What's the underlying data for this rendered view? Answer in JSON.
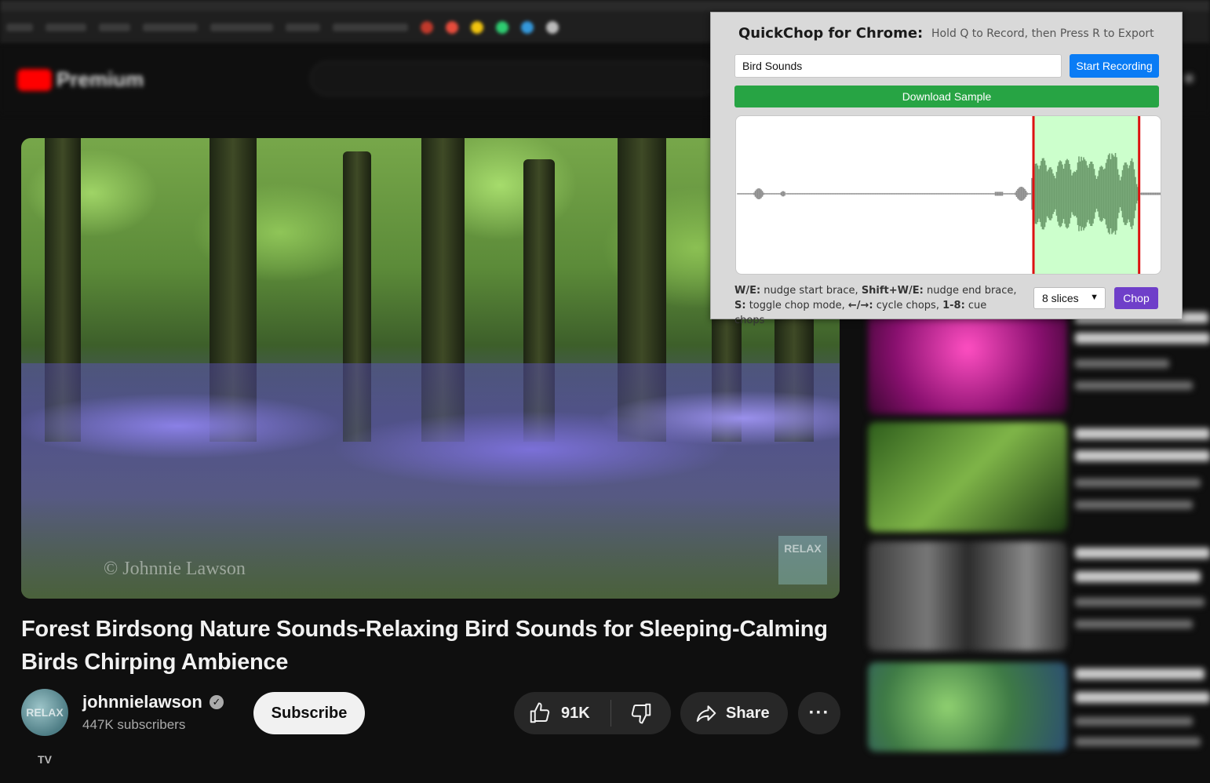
{
  "browser": {
    "bookmark_count": 14
  },
  "youtube": {
    "logo_text": "Premium",
    "video": {
      "watermark": "© Johnnie Lawson",
      "badge": "RELAX",
      "title": "Forest Birdsong Nature Sounds-Relaxing Bird Sounds for Sleeping-Calming Birds Chirping Ambience"
    },
    "channel": {
      "avatar_text": "RELAX TV",
      "name": "johnnielawson",
      "verified_mark": "✓",
      "subscribers": "447K subscribers",
      "subscribe_label": "Subscribe"
    },
    "actions": {
      "like_count": "91K",
      "share_label": "Share",
      "more_label": "···"
    }
  },
  "quickchop": {
    "title": "QuickChop for Chrome:",
    "hint": "Hold Q to Record, then Press R to Export",
    "sample_name_value": "Bird Sounds",
    "start_recording_label": "Start Recording",
    "download_label": "Download Sample",
    "help": {
      "k1": "W/E:",
      "t1": " nudge start brace, ",
      "k2": "Shift+W/E:",
      "t2": " nudge end brace,",
      "k3": "S:",
      "t3": " toggle chop mode, ",
      "k4": "←/→:",
      "t4": " cycle chops, ",
      "k5": "1-8:",
      "t5": " cue chops"
    },
    "slices_value": "8 slices",
    "chop_label": "Chop",
    "selection": {
      "start_fraction": 0.698,
      "end_fraction": 0.946
    },
    "colors": {
      "selection_fill": "#ccffcc",
      "brace": "#dd1111",
      "wave_outside": "#8e8e8e",
      "wave_inside": "#6f9f6f"
    }
  }
}
